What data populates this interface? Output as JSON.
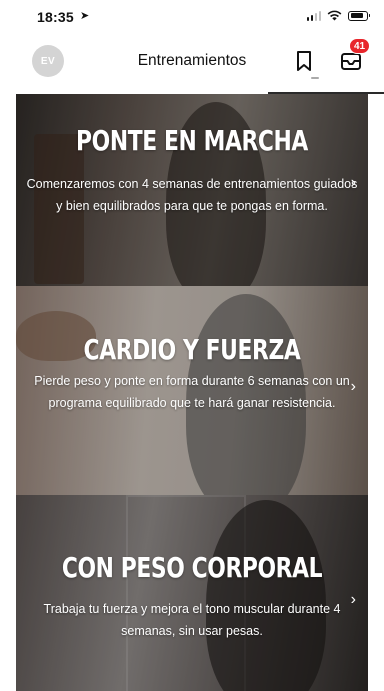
{
  "status_bar": {
    "time": "18:35",
    "location_icon": "location-arrow-icon",
    "signal_bars_filled": 2,
    "battery_level": 0.8
  },
  "header": {
    "avatar_initials": "EV",
    "title": "Entrenamientos",
    "bookmark_icon": "bookmark-icon",
    "inbox_icon": "inbox-icon",
    "inbox_badge": "41"
  },
  "programs": [
    {
      "title": "PONTE EN MARCHA",
      "description": "Comenzaremos con 4 semanas de entrenamientos guiados y bien equilibrados para que te pongas en forma."
    },
    {
      "title": "CARDIO Y FUERZA",
      "description": "Pierde peso y ponte en forma durante 6 semanas con un programa equilibrado que te hará ganar resistencia."
    },
    {
      "title": "CON PESO CORPORAL",
      "description": "Trabaja tu fuerza y mejora el tono muscular durante 4 semanas, sin usar pesas."
    }
  ],
  "colors": {
    "badge": "#e8262c",
    "avatar_bg": "#d4d4d4"
  }
}
